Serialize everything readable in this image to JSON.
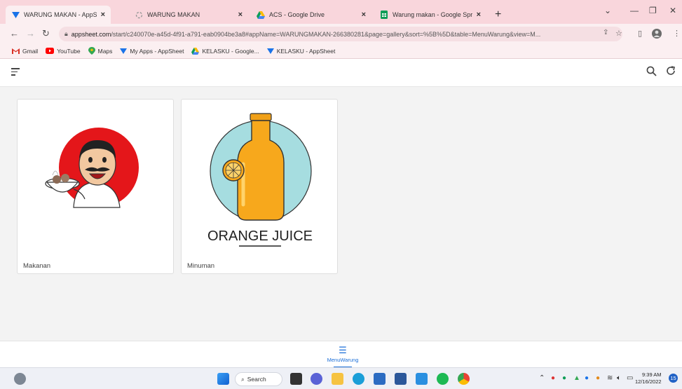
{
  "browser": {
    "tabs": [
      {
        "title": "WARUNG MAKAN - AppSheet",
        "icon": "appsheet-icon"
      },
      {
        "title": "WARUNG MAKAN",
        "icon": "loading-icon"
      },
      {
        "title": "ACS - Google Drive",
        "icon": "google-drive-icon"
      },
      {
        "title": "Warung makan - Google Spreadsh",
        "icon": "google-sheets-icon"
      }
    ],
    "url_host": "appsheet.com",
    "url_path": "/start/c240070e-a45d-4f91-a791-eab0904be3a8#appName=WARUNGMAKAN-266380281&page=gallery&sort=%5B%5D&table=MenuWarung&view=M...",
    "bookmarks": [
      "Gmail",
      "YouTube",
      "Maps",
      "My Apps - AppSheet",
      "KELASKU - Google...",
      "KELASKU - AppSheet"
    ]
  },
  "app": {
    "cards": [
      {
        "caption": "Makanan"
      },
      {
        "caption": "Minuman",
        "image_text": "ORANGE JUICE"
      }
    ],
    "nav": {
      "label": "MenuWarung"
    }
  },
  "taskbar": {
    "search_label": "Search",
    "time": "9:39 AM",
    "date": "12/16/2022",
    "notification_count": "15"
  },
  "colors": {
    "tabstrip": "#f9d6dc",
    "accent": "#1c6fd8",
    "food_circle": "#e4161a",
    "juice_circle": "#a6dde0",
    "juice": "#f7a81c"
  }
}
